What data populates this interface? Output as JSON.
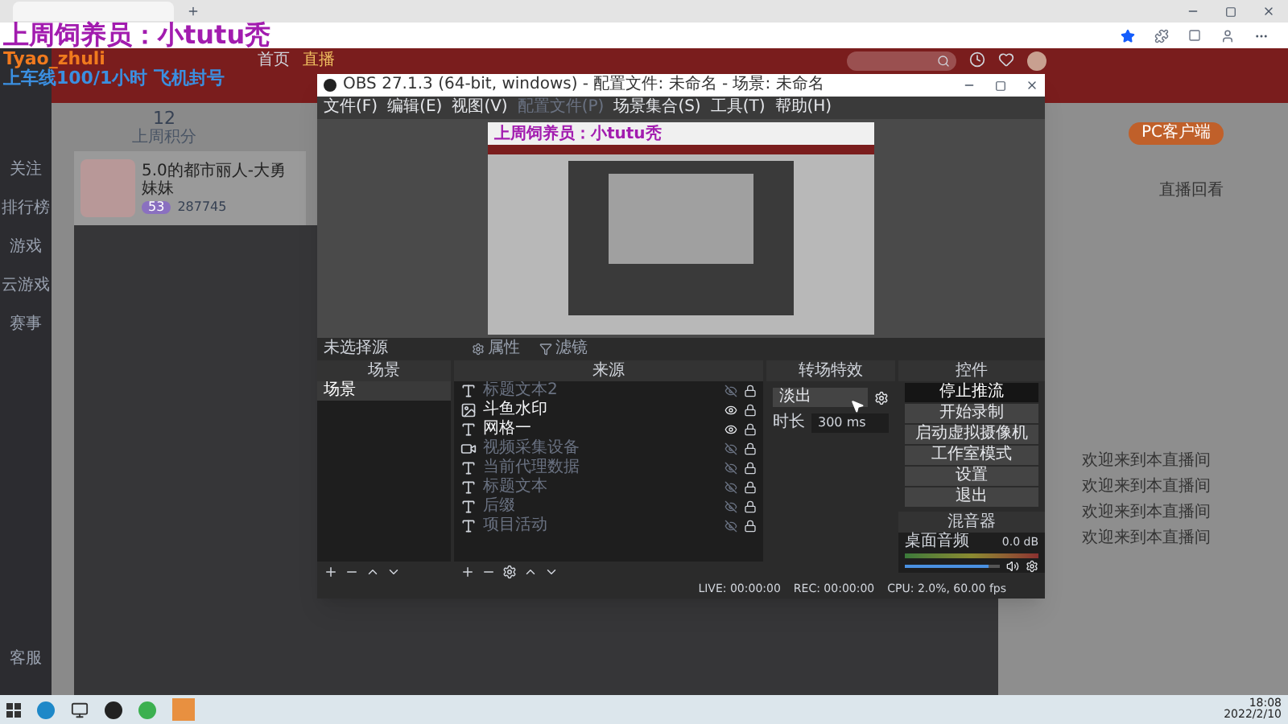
{
  "overlay": {
    "lines": [
      {
        "text": "上周饲养员：小tutu秃",
        "color": "#a21caf"
      },
      {
        "text": "Tyao_zhuli",
        "color": "#f07a1e"
      },
      {
        "text": "上车线100/1小时  飞机封号",
        "color": "#3b8fe0"
      }
    ]
  },
  "site": {
    "nav": [
      {
        "label": "首页",
        "selected": false
      },
      {
        "label": "直播",
        "selected": true
      }
    ],
    "sidebar": [
      {
        "label": "关注"
      },
      {
        "label": "排行榜"
      },
      {
        "label": "游戏"
      },
      {
        "label": "云游戏"
      },
      {
        "label": "赛事"
      }
    ],
    "sidebar_bottom": "客服",
    "stats": {
      "value": "12",
      "label": "上周积分"
    },
    "streamer": {
      "title": "5.0的都市丽人-大勇妹妹",
      "level": "53",
      "heat": "287745"
    },
    "pc_client": "PC客户端",
    "replay": "直播回看",
    "chat": [
      "欢迎来到本直播间",
      "欢迎来到本直播间",
      "欢迎来到本直播间",
      "欢迎来到本直播间"
    ]
  },
  "obs": {
    "title": "OBS 27.1.3 (64-bit, windows) - 配置文件: 未命名 - 场景: 未命名",
    "menu": [
      {
        "label": "文件(F)",
        "disabled": false
      },
      {
        "label": "编辑(E)",
        "disabled": false
      },
      {
        "label": "视图(V)",
        "disabled": false
      },
      {
        "label": "配置文件(P)",
        "disabled": true
      },
      {
        "label": "场景集合(S)",
        "disabled": false
      },
      {
        "label": "工具(T)",
        "disabled": false
      },
      {
        "label": "帮助(H)",
        "disabled": false
      }
    ],
    "preview_overlay": "上周饲养员：小tutu秃",
    "no_source": "未选择源",
    "properties": "属性",
    "filters": "滤镜",
    "scenes": {
      "title": "场景",
      "items": [
        {
          "label": "场景",
          "selected": true
        }
      ]
    },
    "sources": {
      "title": "来源",
      "items": [
        {
          "label": "标题文本2",
          "kind": "text",
          "visible": false
        },
        {
          "label": "斗鱼水印",
          "kind": "image",
          "visible": true
        },
        {
          "label": "网格一",
          "kind": "text",
          "visible": true
        },
        {
          "label": "视频采集设备",
          "kind": "video",
          "visible": false
        },
        {
          "label": "当前代理数据",
          "kind": "text",
          "visible": false
        },
        {
          "label": "标题文本",
          "kind": "text",
          "visible": false
        },
        {
          "label": "后缀",
          "kind": "text",
          "visible": false
        },
        {
          "label": "项目活动",
          "kind": "text",
          "visible": false
        }
      ]
    },
    "transitions": {
      "title": "转场特效",
      "type": "淡出",
      "duration_label": "时长",
      "duration": "300 ms"
    },
    "controls": {
      "title": "控件",
      "buttons": [
        {
          "label": "停止推流",
          "active": true
        },
        {
          "label": "开始录制",
          "active": false
        },
        {
          "label": "启动虚拟摄像机",
          "active": false
        },
        {
          "label": "工作室模式",
          "active": false
        },
        {
          "label": "设置",
          "active": false
        },
        {
          "label": "退出",
          "active": false
        }
      ]
    },
    "mixer": {
      "title": "混音器",
      "channels": [
        {
          "name": "桌面音频",
          "reading": "0.0 dB",
          "level": 0.88,
          "muted": false
        }
      ]
    },
    "status": {
      "live": "LIVE: 00:00:00",
      "rec": "REC: 00:00:00",
      "cpu": "CPU: 2.0%, 60.00 fps"
    }
  },
  "taskbar": {
    "time": "18:08",
    "date": "2022/2/10"
  }
}
